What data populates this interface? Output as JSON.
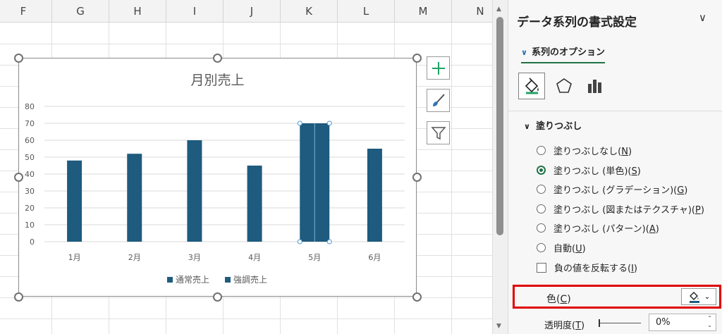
{
  "sheet": {
    "columns": [
      "F",
      "G",
      "H",
      "I",
      "J",
      "K",
      "L",
      "M",
      "N"
    ]
  },
  "chart_data": {
    "type": "bar",
    "title": "月別売上",
    "categories": [
      "1月",
      "2月",
      "3月",
      "4月",
      "5月",
      "6月"
    ],
    "series": [
      {
        "name": "通常売上",
        "values": [
          48,
          52,
          60,
          45,
          0,
          55
        ]
      },
      {
        "name": "強調売上",
        "values": [
          0,
          0,
          0,
          0,
          70,
          0
        ]
      }
    ],
    "yticks": [
      0,
      10,
      20,
      30,
      40,
      50,
      60,
      70,
      80
    ],
    "ylim": [
      0,
      80
    ],
    "grid": true,
    "legend": "bottom",
    "bar_color": "#1e5b7e"
  },
  "panel": {
    "title": "データ系列の書式設定",
    "series_tab": "系列のオプション",
    "section_fill": "塗りつぶし",
    "fill_options": [
      {
        "label": "塗りつぶしなし(",
        "key": "N",
        "selected": false
      },
      {
        "label": "塗りつぶし (単色)(",
        "key": "S",
        "selected": true
      },
      {
        "label": "塗りつぶし (グラデーション)(",
        "key": "G",
        "selected": false
      },
      {
        "label": "塗りつぶし (図またはテクスチャ)(",
        "key": "P",
        "selected": false
      },
      {
        "label": "塗りつぶし (パターン)(",
        "key": "A",
        "selected": false
      },
      {
        "label": "自動(",
        "key": "U",
        "selected": false
      }
    ],
    "invert_label": "負の値を反転する(",
    "invert_key": "I",
    "color_label": "色(",
    "color_key": "C",
    "color_swatch": "#1e5b7e",
    "transparency_label": "透明度(",
    "transparency_key": "T",
    "transparency_value": "0%"
  }
}
